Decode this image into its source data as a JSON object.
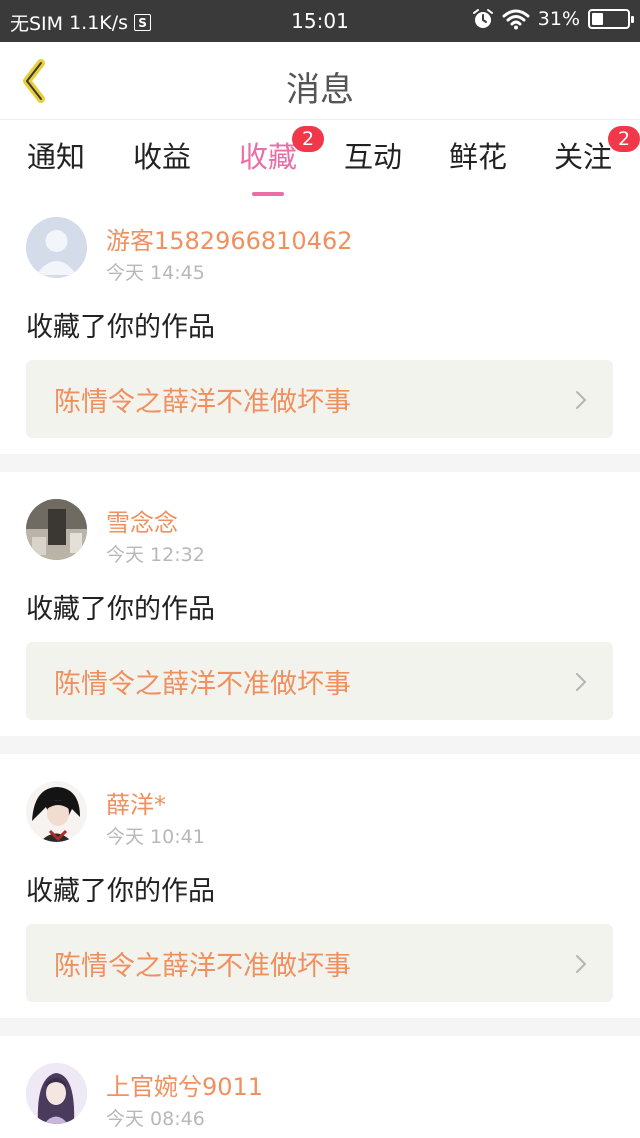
{
  "status_bar": {
    "carrier": "无SIM",
    "speed": "1.1K/s",
    "s_icon": "S",
    "time": "15:01",
    "battery": "31%",
    "battery_level": 0.31
  },
  "header": {
    "title": "消息"
  },
  "tabs": [
    {
      "label": "通知",
      "badge": ""
    },
    {
      "label": "收益",
      "badge": ""
    },
    {
      "label": "收藏",
      "badge": "2",
      "active": true
    },
    {
      "label": "互动",
      "badge": ""
    },
    {
      "label": "鲜花",
      "badge": ""
    },
    {
      "label": "关注",
      "badge": "2"
    }
  ],
  "messages": [
    {
      "user": "游客1582966810462",
      "time": "今天 14:45",
      "action": "收藏了你的作品",
      "work_title": "陈情令之薛洋不准做坏事",
      "avatar": "default-avatar"
    },
    {
      "user": "雪念念",
      "time": "今天 12:32",
      "action": "收藏了你的作品",
      "work_title": "陈情令之薛洋不准做坏事",
      "avatar": "photo-avatar"
    },
    {
      "user": "薛洋*",
      "time": "今天 10:41",
      "action": "收藏了你的作品",
      "work_title": "陈情令之薛洋不准做坏事",
      "avatar": "anime-avatar"
    },
    {
      "user": "上官婉兮9011",
      "time": "今天 08:46",
      "action": "",
      "work_title": "",
      "avatar": "girl-avatar"
    }
  ],
  "colors": {
    "accent": "#e96fa6",
    "badge": "#f0384a",
    "name": "#f0905e",
    "status_bar": "#3a3a3a"
  }
}
